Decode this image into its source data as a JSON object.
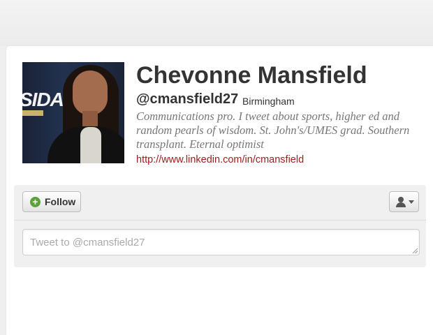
{
  "profile": {
    "name": "Chevonne Mansfield",
    "handle": "@cmansfield27",
    "location": "Birmingham",
    "bio": "Communications pro. I tweet about sports, higher ed and random pearls of wisdom. St. John's/UMES grad. Southern transplant. Eternal optimist",
    "url": "http://www.linkedin.com/in/cmansfield",
    "avatar_banner_text": "SIDA"
  },
  "actions": {
    "follow_label": "Follow",
    "follow_icon": "plus-circle-icon",
    "user_menu_icon": "user-icon",
    "tweet_placeholder": "Tweet to @cmansfield27"
  },
  "colors": {
    "name_text": "#333333",
    "bio_text": "#777777",
    "url_link": "#9a1d1d",
    "follow_icon_green": "#5aa23a",
    "panel_bg": "#f0f0f0"
  }
}
